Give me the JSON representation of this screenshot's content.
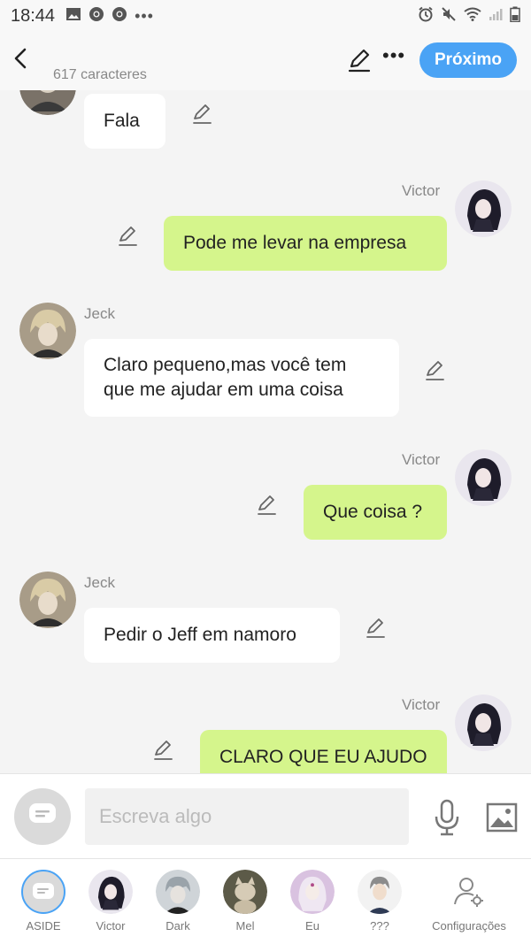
{
  "status_bar": {
    "time": "18:44",
    "left_icons": [
      "gallery-icon",
      "chrome-icon",
      "chrome-icon",
      "more-dots-icon"
    ],
    "right_icons": [
      "alarm-icon",
      "mute-icon",
      "wifi-icon",
      "signal-icon",
      "battery-icon"
    ]
  },
  "header": {
    "char_count": "617 caracteres",
    "next_label": "Próximo",
    "accent": "#4aa3f5"
  },
  "messages": [
    {
      "side": "left",
      "author": "",
      "text": "Fala"
    },
    {
      "side": "right",
      "author": "Victor",
      "text": "Pode me levar na empresa"
    },
    {
      "side": "left",
      "author": "Jeck",
      "lines": [
        "Claro pequeno,mas você tem",
        "que me ajudar em uma coisa"
      ]
    },
    {
      "side": "right",
      "author": "Victor",
      "text": "Que coisa ?"
    },
    {
      "side": "left",
      "author": "Jeck",
      "text": "Pedir o Jeff em namoro"
    },
    {
      "side": "right",
      "author": "Victor",
      "text": "CLARO QUE EU AJUDO"
    }
  ],
  "colors": {
    "own_bubble": "#d5f58c",
    "other_bubble": "#ffffff",
    "background": "#f4f4f4"
  },
  "input": {
    "placeholder": "Escreva algo"
  },
  "tabs": [
    {
      "label": "ASIDE",
      "icon": "chat-bubble-icon"
    },
    {
      "label": "Victor"
    },
    {
      "label": "Dark"
    },
    {
      "label": "Mel"
    },
    {
      "label": "Eu"
    },
    {
      "label": "???"
    },
    {
      "label": "Configurações",
      "icon": "user-settings-icon"
    }
  ]
}
